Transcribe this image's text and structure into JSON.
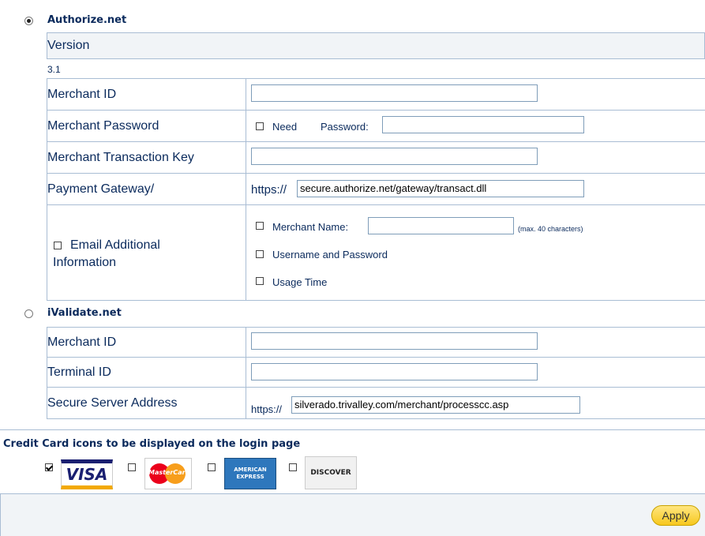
{
  "authorize": {
    "title": "Authorize.net",
    "selected": true,
    "version_label": "Version",
    "version_value": "3.1",
    "merchant_id_label": "Merchant ID",
    "merchant_id_value": "",
    "merchant_password_label": "Merchant Password",
    "need_label": "Need",
    "password_label": "Password:",
    "password_value": "",
    "transaction_key_label": "Merchant Transaction Key",
    "transaction_key_value": "",
    "gateway_label": "Payment Gateway/",
    "gateway_prefix": "https://",
    "gateway_value": "secure.authorize.net/gateway/transact.dll",
    "email_info_label": "Email Additional Information",
    "merchant_name_label": "Merchant Name:",
    "merchant_name_value": "",
    "merchant_name_hint": "(max. 40 characters)",
    "username_password_label": "Username and Password",
    "usage_time_label": "Usage Time"
  },
  "ivalidate": {
    "title": "iValidate.net",
    "selected": false,
    "merchant_id_label": "Merchant ID",
    "merchant_id_value": "",
    "terminal_id_label": "Terminal ID",
    "terminal_id_value": "",
    "server_address_label": "Secure Server Address",
    "server_prefix": "https://",
    "server_value": "silverado.trivalley.com/merchant/processcc.asp"
  },
  "credit_cards": {
    "heading": "Credit Card icons to be displayed on the login page",
    "cards": [
      {
        "name": "VISA",
        "checked": true
      },
      {
        "name": "MasterCard",
        "checked": false
      },
      {
        "name": "AMERICAN EXPRESS",
        "checked": false
      },
      {
        "name": "DISCOVER",
        "checked": false
      }
    ]
  },
  "actions": {
    "apply_label": "Apply"
  },
  "colors": {
    "text": "#0a2a5c",
    "border": "#a9bdd4",
    "button": "#f7c81e"
  }
}
